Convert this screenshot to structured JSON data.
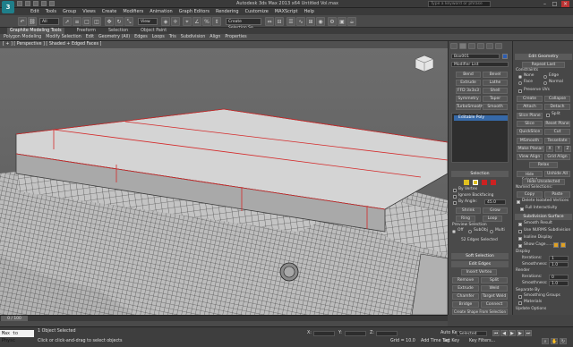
{
  "app": {
    "logo": "3",
    "title": "Autodesk 3ds Max 2013 x64    Untitled    Vol.max",
    "search_placeholder": "Type a keyword or phrase"
  },
  "menu": [
    "Edit",
    "Tools",
    "Group",
    "Views",
    "Create",
    "Modifiers",
    "Animation",
    "Graph Editors",
    "Rendering",
    "Customize",
    "MAXScript",
    "Help"
  ],
  "toolbar": {
    "selection_filter": "All",
    "view_dropdown": "View",
    "named_selection": "Create Selection Se"
  },
  "ribbon": {
    "tabs": [
      "Graphite Modeling Tools",
      "Freeform",
      "Selection",
      "Object Paint"
    ],
    "sub": [
      "Polygon Modeling",
      "Modify Selection",
      "Edit",
      "Geometry (All)",
      "Edges",
      "Loops",
      "Tris",
      "Subdivision",
      "Align",
      "Properties"
    ]
  },
  "viewport": {
    "label": "[ + ] [ Perspective ] [ Shaded + Edged Faces ]"
  },
  "command_panel": {
    "object_name": "Box001",
    "modifier_list": "Modifier List",
    "modifier_buttons": [
      "Bend",
      "Bevel",
      "Extrude",
      "Lathe",
      "FFD 3x3x3",
      "Shell",
      "Symmetry",
      "Taper",
      "TurboSmooth",
      "Smooth"
    ],
    "stack_item": "Editable Poly",
    "selection": {
      "header": "Selection",
      "by_vertex": "By Vertex",
      "ignore_backfacing": "Ignore Backfacing",
      "by_angle": "By Angle:",
      "by_angle_value": "45.0",
      "shrink": "Shrink",
      "grow": "Grow",
      "ring": "Ring",
      "loop": "Loop",
      "preview_selection": "Preview Selection",
      "preview_off": "Off",
      "preview_subobj": "SubObj",
      "preview_multi": "Multi",
      "status": "52 Edges Selected"
    },
    "soft_selection": "Soft Selection",
    "edit_edges": {
      "header": "Edit Edges",
      "insert_vertex": "Insert Vertex",
      "remove": "Remove",
      "split": "Split",
      "extrude": "Extrude",
      "weld": "Weld",
      "chamfer": "Chamfer",
      "target_weld": "Target Weld",
      "bridge": "Bridge",
      "connect": "Connect",
      "create_shape": "Create Shape From Selection",
      "weight_label": "Weight:",
      "weight_value": "1.0",
      "crease_label": "Crease:",
      "crease_value": "0.0"
    }
  },
  "right_panel": {
    "edit_geometry": "Edit Geometry",
    "repeat_last": "Repeat Last",
    "constraints": "Constraints",
    "c_none": "None",
    "c_edge": "Edge",
    "c_face": "Face",
    "c_normal": "Normal",
    "preserve_uvs": "Preserve UVs",
    "create": "Create",
    "collapse": "Collapse",
    "attach": "Attach",
    "detach": "Detach",
    "slice_plane": "Slice Plane",
    "split": "Split",
    "slice": "Slice",
    "reset_plane": "Reset Plane",
    "quickslice": "QuickSlice",
    "cut": "Cut",
    "msmooth": "MSmooth",
    "tessellate": "Tessellate",
    "make_planar": "Make Planar",
    "x": "X",
    "y": "Y",
    "z": "Z",
    "view_align": "View Align",
    "grid_align": "Grid Align",
    "relax": "Relax",
    "hide_selected": "Hide Selected",
    "unhide_all": "Unhide All",
    "hide_unselected": "Hide Unselected",
    "named_selections": "Named Selections:",
    "copy": "Copy",
    "paste": "Paste",
    "delete_isolated": "Delete Isolated Vertices",
    "full_interactivity": "Full Interactivity",
    "subdivision_surface": "Subdivision Surface",
    "smooth_result": "Smooth Result",
    "use_nurms": "Use NURMS Subdivision",
    "isoline_display": "Isoline Display",
    "show_cage": "Show Cage......",
    "display": "Display",
    "iterations_label": "Iterations:",
    "iterations_value": "1",
    "smoothness_label": "Smoothness:",
    "smoothness_value": "1.0",
    "render": "Render",
    "r_iterations_value": "0",
    "r_smoothness_value": "1.0",
    "separate_by": "Separate By",
    "smoothing_groups": "Smoothing Groups",
    "materials": "Materials",
    "update_options": "Update Options",
    "always": "Always",
    "when_rendering": "When Rendering",
    "manually": "Manually"
  },
  "timeline": {
    "frame": "0 / 100"
  },
  "status": {
    "maxscript": "Max to Physc",
    "objects_selected": "1 Object Selected",
    "prompt": "Click or click-and-drag to select objects",
    "x_label": "X:",
    "y_label": "Y:",
    "z_label": "Z:",
    "grid": "Grid = 10.0",
    "add_time_tag": "Add Time Tag",
    "auto_key": "Auto Key",
    "set_key": "Set Key",
    "key_mode": "Selected",
    "key_filters": "Key Filters..."
  },
  "colors": {
    "accent": "#3669a8",
    "mesh_edge": "#2a2a2a",
    "selected_edge": "#d42a2a",
    "object_fill": "#c8c8c8"
  }
}
